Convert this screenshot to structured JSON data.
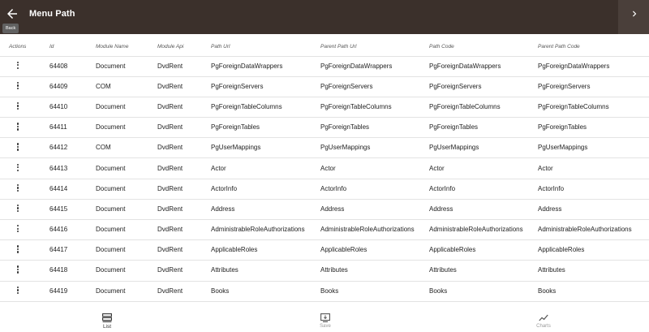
{
  "header": {
    "title": "Menu Path",
    "back_tooltip": "Back"
  },
  "table": {
    "columns": [
      "Actions",
      "Id",
      "Module Name",
      "Module Api",
      "Path Url",
      "Parent Path Url",
      "Path Code",
      "Parent Path Code"
    ],
    "rows": [
      {
        "id": "64408",
        "module_name": "Document",
        "module_api": "DvdRent",
        "path_url": "PgForeignDataWrappers",
        "parent_path_url": "PgForeignDataWrappers",
        "path_code": "PgForeignDataWrappers",
        "parent_path_code": "PgForeignDataWrappers"
      },
      {
        "id": "64409",
        "module_name": "COM",
        "module_api": "DvdRent",
        "path_url": "PgForeignServers",
        "parent_path_url": "PgForeignServers",
        "path_code": "PgForeignServers",
        "parent_path_code": "PgForeignServers"
      },
      {
        "id": "64410",
        "module_name": "Document",
        "module_api": "DvdRent",
        "path_url": "PgForeignTableColumns",
        "parent_path_url": "PgForeignTableColumns",
        "path_code": "PgForeignTableColumns",
        "parent_path_code": "PgForeignTableColumns"
      },
      {
        "id": "64411",
        "module_name": "Document",
        "module_api": "DvdRent",
        "path_url": "PgForeignTables",
        "parent_path_url": "PgForeignTables",
        "path_code": "PgForeignTables",
        "parent_path_code": "PgForeignTables"
      },
      {
        "id": "64412",
        "module_name": "COM",
        "module_api": "DvdRent",
        "path_url": "PgUserMappings",
        "parent_path_url": "PgUserMappings",
        "path_code": "PgUserMappings",
        "parent_path_code": "PgUserMappings"
      },
      {
        "id": "64413",
        "module_name": "Document",
        "module_api": "DvdRent",
        "path_url": "Actor",
        "parent_path_url": "Actor",
        "path_code": "Actor",
        "parent_path_code": "Actor"
      },
      {
        "id": "64414",
        "module_name": "Document",
        "module_api": "DvdRent",
        "path_url": "ActorInfo",
        "parent_path_url": "ActorInfo",
        "path_code": "ActorInfo",
        "parent_path_code": "ActorInfo"
      },
      {
        "id": "64415",
        "module_name": "Document",
        "module_api": "DvdRent",
        "path_url": "Address",
        "parent_path_url": "Address",
        "path_code": "Address",
        "parent_path_code": "Address"
      },
      {
        "id": "64416",
        "module_name": "Document",
        "module_api": "DvdRent",
        "path_url": "AdministrableRoleAuthorizations",
        "parent_path_url": "AdministrableRoleAuthorizations",
        "path_code": "AdministrableRoleAuthorizations",
        "parent_path_code": "AdministrableRoleAuthorizations"
      },
      {
        "id": "64417",
        "module_name": "Document",
        "module_api": "DvdRent",
        "path_url": "ApplicableRoles",
        "parent_path_url": "ApplicableRoles",
        "path_code": "ApplicableRoles",
        "parent_path_code": "ApplicableRoles"
      },
      {
        "id": "64418",
        "module_name": "Document",
        "module_api": "DvdRent",
        "path_url": "Attributes",
        "parent_path_url": "Attributes",
        "path_code": "Attributes",
        "parent_path_code": "Attributes"
      },
      {
        "id": "64419",
        "module_name": "Document",
        "module_api": "DvdRent",
        "path_url": "Books",
        "parent_path_url": "Books",
        "path_code": "Books",
        "parent_path_code": "Books"
      }
    ]
  },
  "bottom_nav": {
    "items": [
      {
        "label": "List",
        "icon": "list-icon",
        "active": true
      },
      {
        "label": "Save",
        "icon": "save-icon",
        "active": false
      },
      {
        "label": "Charts",
        "icon": "chart-icon",
        "active": false
      }
    ]
  },
  "colors": {
    "appbar": "#3b302b",
    "right_panel": "#4a3f3a",
    "divider": "#e3e3e3"
  }
}
